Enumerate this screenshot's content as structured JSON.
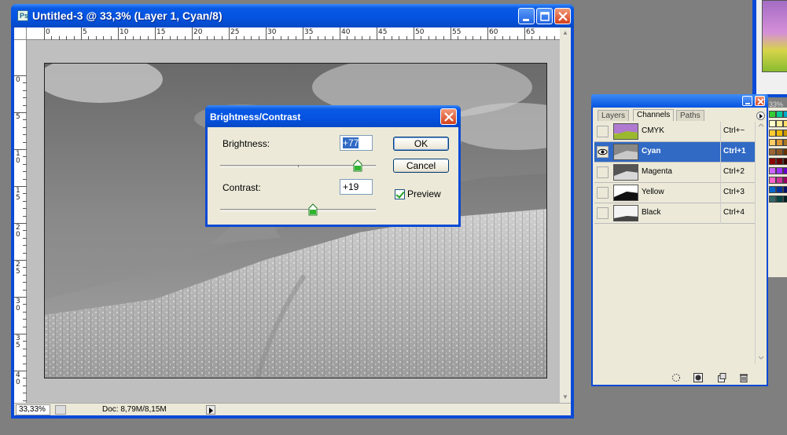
{
  "document": {
    "title": "Untitled-3 @ 33,3% (Layer 1, Cyan/8)",
    "zoom": "33,33%",
    "doc_info": "Doc: 8,79M/8,15M",
    "ruler_h_labels": [
      "0",
      "5",
      "10",
      "15",
      "20",
      "25",
      "30",
      "35",
      "40",
      "45",
      "50",
      "55",
      "60",
      "65"
    ],
    "ruler_v_labels": [
      "0",
      "5",
      "10",
      "15",
      "20",
      "25",
      "30",
      "35",
      "40"
    ]
  },
  "dialog": {
    "title": "Brightness/Contrast",
    "brightness_label": "Brightness:",
    "brightness_value": "+77",
    "brightness_fraction": 0.885,
    "contrast_label": "Contrast:",
    "contrast_value": "+19",
    "contrast_fraction": 0.595,
    "ok_label": "OK",
    "cancel_label": "Cancel",
    "preview_label": "Preview"
  },
  "channels_panel": {
    "tabs": [
      "Layers",
      "Channels",
      "Paths"
    ],
    "active_tab": "Channels",
    "channels": [
      {
        "name": "CMYK",
        "shortcut": "Ctrl+~",
        "selected": false,
        "visible": false
      },
      {
        "name": "Cyan",
        "shortcut": "Ctrl+1",
        "selected": true,
        "visible": true
      },
      {
        "name": "Magenta",
        "shortcut": "Ctrl+2",
        "selected": false,
        "visible": false
      },
      {
        "name": "Yellow",
        "shortcut": "Ctrl+3",
        "selected": false,
        "visible": false
      },
      {
        "name": "Black",
        "shortcut": "Ctrl+4",
        "selected": false,
        "visible": false
      }
    ]
  },
  "bg_window": {
    "zoom": "33%"
  },
  "swatch_colors": [
    "#33cc33",
    "#00cc99",
    "#00aacc",
    "#ffffcc",
    "#ffee99",
    "#ffdd66",
    "#ffcc33",
    "#eebb00",
    "#cc9900",
    "#ffcc66",
    "#dd9933",
    "#aa7722",
    "#996633",
    "#885522",
    "#663300",
    "#8b0000",
    "#660000",
    "#330000",
    "#cc66ff",
    "#9933ff",
    "#6600cc",
    "#ff66cc",
    "#cc3399",
    "#990066",
    "#0066cc",
    "#003399",
    "#001166",
    "#336666",
    "#004444",
    "#002222"
  ]
}
